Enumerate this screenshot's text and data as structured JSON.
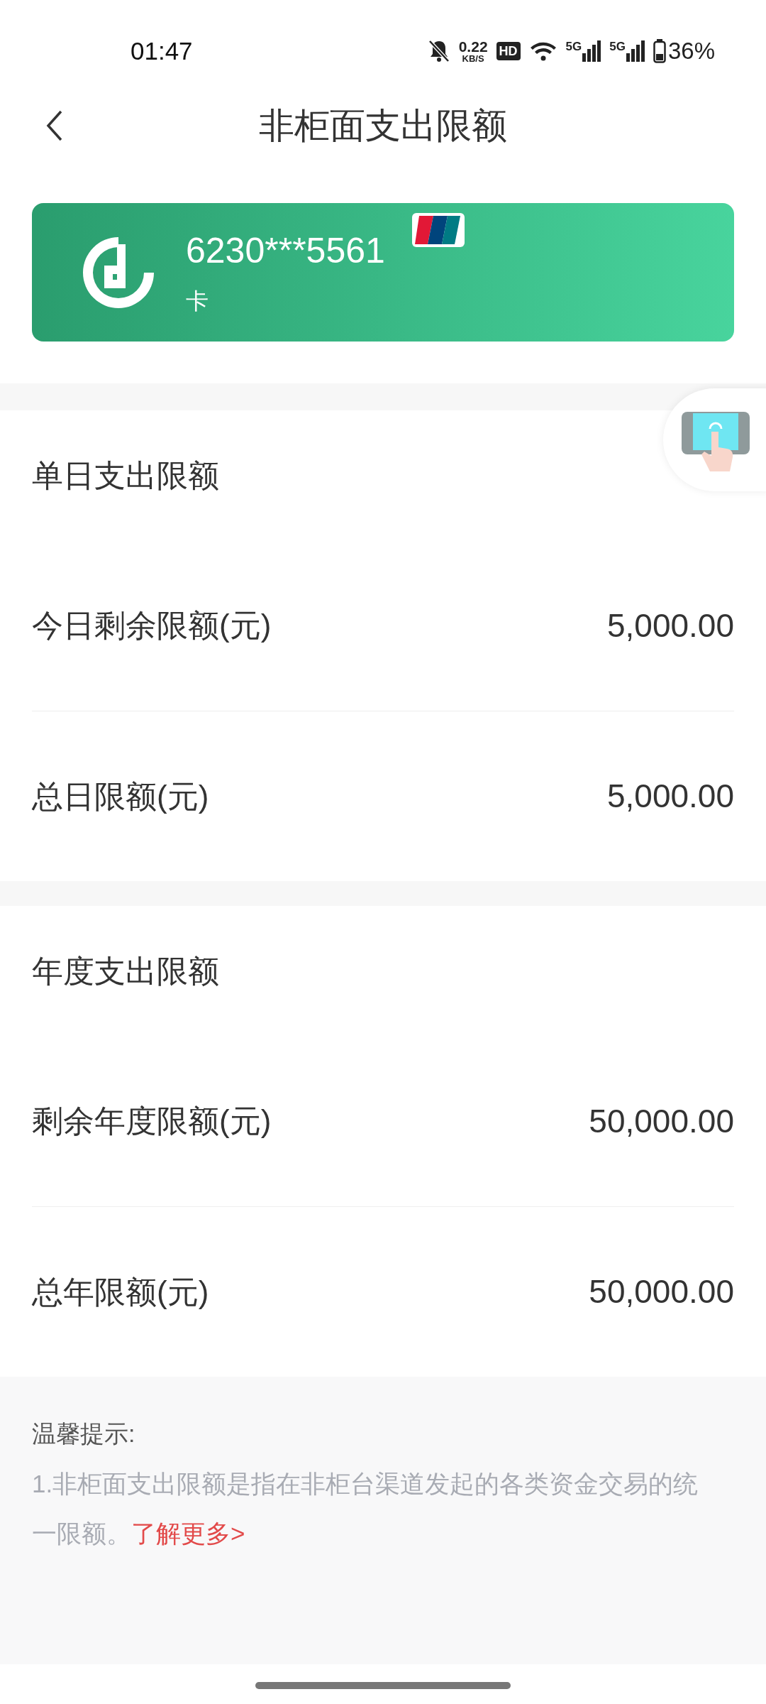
{
  "status_bar": {
    "time": "01:47",
    "net_speed": "0.22",
    "net_unit": "KB/S",
    "hd": "HD",
    "sim1": "5G",
    "sim2": "5G",
    "battery": "36%"
  },
  "header": {
    "title": "非柜面支出限额"
  },
  "card": {
    "number": "6230***5561",
    "type": "卡"
  },
  "sections": [
    {
      "title": "单日支出限额",
      "rows": [
        {
          "label": "今日剩余限额(元)",
          "value": "5,000.00"
        },
        {
          "label": "总日限额(元)",
          "value": "5,000.00"
        }
      ]
    },
    {
      "title": "年度支出限额",
      "rows": [
        {
          "label": "剩余年度限额(元)",
          "value": "50,000.00"
        },
        {
          "label": "总年限额(元)",
          "value": "50,000.00"
        }
      ]
    }
  ],
  "tips": {
    "title": "温馨提示:",
    "text": "1.非柜面支出限额是指在非柜台渠道发起的各类资金交易的统一限额。",
    "link": "了解更多>"
  }
}
